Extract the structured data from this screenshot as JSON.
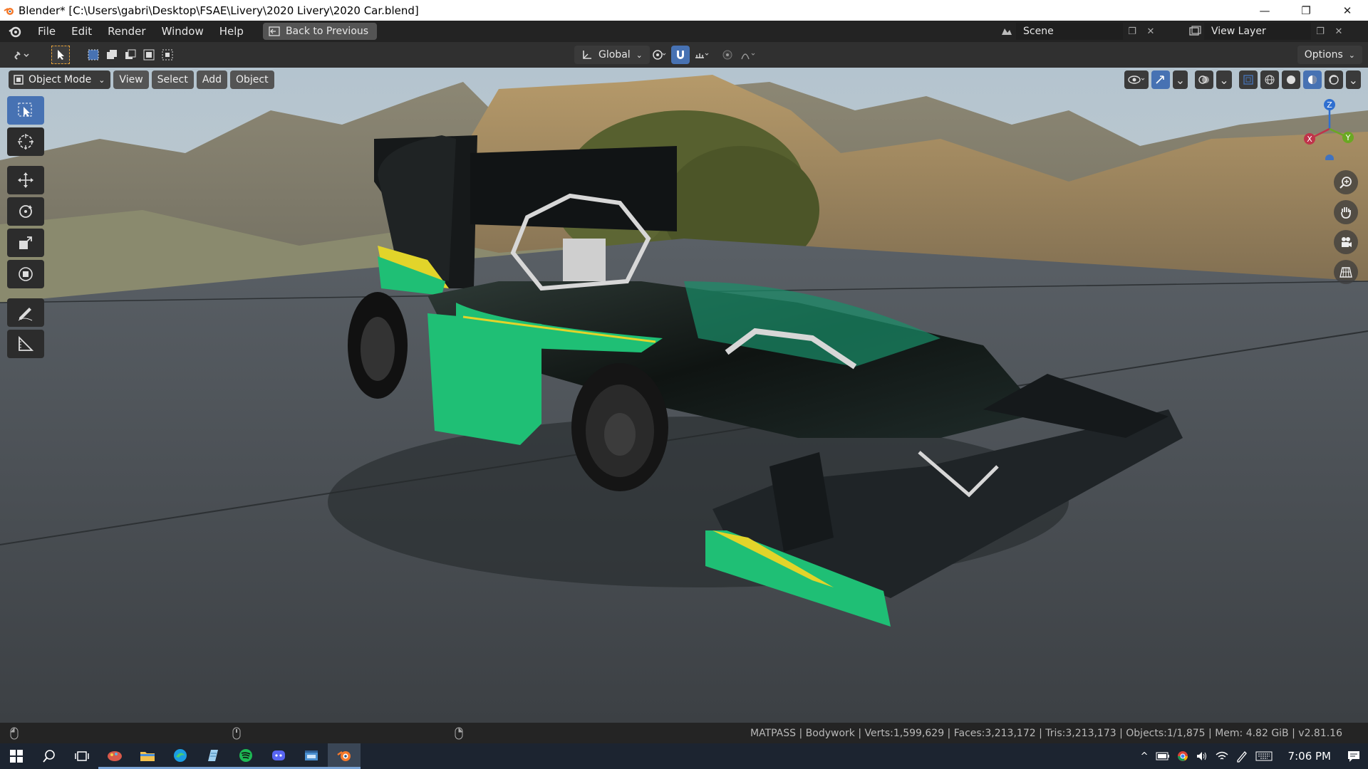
{
  "window": {
    "title": "Blender* [C:\\Users\\gabri\\Desktop\\FSAE\\Livery\\2020 Livery\\2020 Car.blend]",
    "minimize": "—",
    "restore": "❐",
    "close": "✕"
  },
  "menubar": {
    "items": [
      "File",
      "Edit",
      "Render",
      "Window",
      "Help"
    ],
    "back_button": "Back to Previous",
    "scene_label": "Scene",
    "view_layer_label": "View Layer"
  },
  "tool_header": {
    "transform_orientation": "Global",
    "options_label": "Options"
  },
  "viewport_header": {
    "mode": "Object Mode",
    "menus": [
      "View",
      "Select",
      "Add",
      "Object"
    ]
  },
  "gizmo": {
    "x": "X",
    "y": "Y",
    "z": "Z"
  },
  "statusbar": {
    "text": "MATPASS | Bodywork | Verts:1,599,629 | Faces:3,213,172 | Tris:3,213,173 | Objects:1/1,875 | Mem: 4.82 GiB | v2.81.16"
  },
  "taskbar": {
    "time": "7:06 PM"
  },
  "colors": {
    "accent_blue": "#4772b3",
    "livery_green": "#1fbf75",
    "livery_yellow": "#e2d42a"
  }
}
